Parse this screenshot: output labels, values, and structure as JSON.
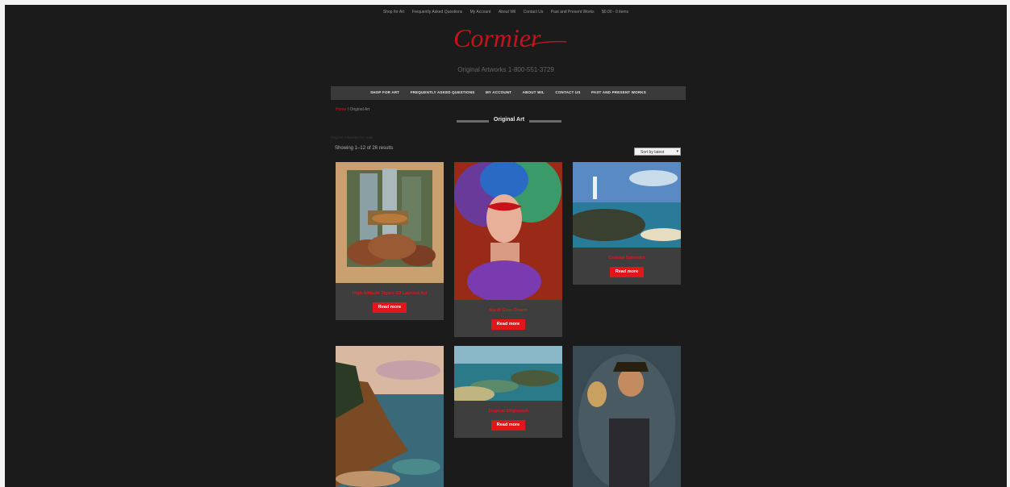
{
  "top_menu": [
    "Shop for Art",
    "Frequently Asked Questions",
    "My Account",
    "About Wil",
    "Contact Us",
    "Past and Present Works",
    "$0.00 - 0 items"
  ],
  "brand": {
    "logo_text": "Cormier",
    "tagline": "Original Artworks 1-800-551-3729"
  },
  "main_nav": [
    "SHOP FOR ART",
    "FREQUENTLY ASKED QUESTIONS",
    "MY ACCOUNT",
    "ABOUT WIL",
    "CONTACT US",
    "PAST AND PRESENT WORKS"
  ],
  "breadcrumb": {
    "home": "Home",
    "current": " / Original Art"
  },
  "section_title": "Original Art",
  "subtitle": "Original Artworks For Sale",
  "results_text": "Showing 1–12 of 26 results",
  "sort_label": "Sort by latest",
  "products": [
    {
      "title": "High Altitude Tigers 3D Layered Art",
      "button": "Read more"
    },
    {
      "title": "Mardi Gras Charm",
      "button": "Read more"
    },
    {
      "title": "Coastal Splendor",
      "button": "Read more"
    },
    {
      "title": "",
      "button": ""
    },
    {
      "title": "Tropical Shipwreck",
      "button": "Read more"
    },
    {
      "title": "",
      "button": ""
    }
  ],
  "colors": {
    "background": "#1b1b1b",
    "accent": "#e0161a",
    "card": "#3e3e3e",
    "navbar": "#3a3a3a"
  }
}
